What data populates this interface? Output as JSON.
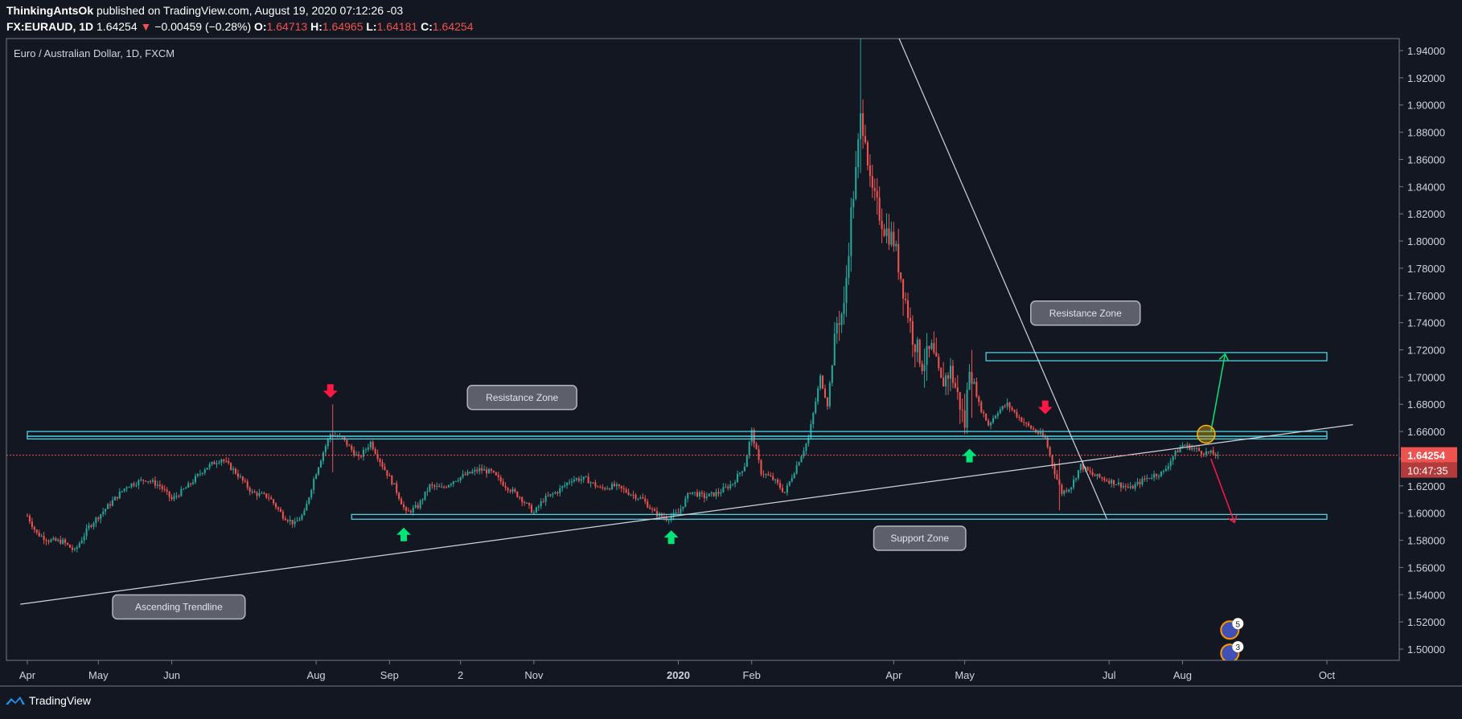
{
  "header": {
    "author": "ThinkingAntsOk",
    "published_text": "published on TradingView.com, August 19, 2020 07:12:26 -03",
    "symbol": "FX:EURAUD, 1D",
    "last": "1.64254",
    "change_arrow": "▼",
    "change": "−0.00459 (−0.28%)",
    "open_label": "O:",
    "open": "1.64713",
    "high_label": "H:",
    "high": "1.64965",
    "low_label": "L:",
    "low": "1.64181",
    "close_label": "C:",
    "close": "1.64254"
  },
  "footer": {
    "brand": "TradingView",
    "logo_icon": "tradingview-logo-icon"
  },
  "colors": {
    "background": "#131722",
    "up": "#26a69a",
    "down": "#ef5350",
    "zone": "#4dd0e1",
    "trendline": "#d1d4dc",
    "grid_text": "#d1d4dc",
    "arrow_up": "#00e676",
    "arrow_down": "#ff1744",
    "callout_bg": "#5d606b"
  },
  "chart_data": {
    "type": "candlestick",
    "title": "Euro / Australian Dollar, 1D, FXCM",
    "ylim": [
      1.49,
      1.95
    ],
    "y_ticks": [
      "1.94000",
      "1.92000",
      "1.90000",
      "1.88000",
      "1.86000",
      "1.84000",
      "1.82000",
      "1.80000",
      "1.78000",
      "1.76000",
      "1.74000",
      "1.72000",
      "1.70000",
      "1.68000",
      "1.66000",
      "1.64000",
      "1.62000",
      "1.60000",
      "1.58000",
      "1.56000",
      "1.54000",
      "1.52000",
      "1.50000"
    ],
    "x_ticks": [
      {
        "t": 0,
        "label": "Apr"
      },
      {
        "t": 30,
        "label": "May"
      },
      {
        "t": 61,
        "label": "Jun"
      },
      {
        "t": 122,
        "label": "Aug"
      },
      {
        "t": 153,
        "label": "Sep"
      },
      {
        "t": 183,
        "label": "2"
      },
      {
        "t": 214,
        "label": "Nov"
      },
      {
        "t": 275,
        "label": "2020",
        "bold": true
      },
      {
        "t": 306,
        "label": "Feb"
      },
      {
        "t": 366,
        "label": "Apr"
      },
      {
        "t": 396,
        "label": "May"
      },
      {
        "t": 457,
        "label": "Jul"
      },
      {
        "t": 488,
        "label": "Aug"
      },
      {
        "t": 549,
        "label": "Oct"
      }
    ],
    "price_path": [
      [
        0,
        1.598
      ],
      [
        4,
        1.585
      ],
      [
        9,
        1.58
      ],
      [
        15,
        1.579
      ],
      [
        20,
        1.572
      ],
      [
        26,
        1.59
      ],
      [
        34,
        1.605
      ],
      [
        42,
        1.62
      ],
      [
        50,
        1.625
      ],
      [
        56,
        1.62
      ],
      [
        61,
        1.61
      ],
      [
        68,
        1.62
      ],
      [
        75,
        1.633
      ],
      [
        82,
        1.64
      ],
      [
        88,
        1.63
      ],
      [
        95,
        1.615
      ],
      [
        102,
        1.612
      ],
      [
        108,
        1.598
      ],
      [
        113,
        1.592
      ],
      [
        117,
        1.6
      ],
      [
        121,
        1.625
      ],
      [
        125,
        1.645
      ],
      [
        128,
        1.658
      ],
      [
        133,
        1.655
      ],
      [
        140,
        1.64
      ],
      [
        145,
        1.652
      ],
      [
        150,
        1.635
      ],
      [
        155,
        1.62
      ],
      [
        160,
        1.6
      ],
      [
        165,
        1.605
      ],
      [
        170,
        1.62
      ],
      [
        175,
        1.618
      ],
      [
        180,
        1.624
      ],
      [
        185,
        1.628
      ],
      [
        191,
        1.632
      ],
      [
        196,
        1.63
      ],
      [
        202,
        1.62
      ],
      [
        208,
        1.612
      ],
      [
        214,
        1.6
      ],
      [
        218,
        1.61
      ],
      [
        224,
        1.616
      ],
      [
        230,
        1.625
      ],
      [
        236,
        1.625
      ],
      [
        242,
        1.618
      ],
      [
        248,
        1.62
      ],
      [
        254,
        1.615
      ],
      [
        260,
        1.61
      ],
      [
        265,
        1.6
      ],
      [
        270,
        1.596
      ],
      [
        275,
        1.6
      ],
      [
        280,
        1.616
      ],
      [
        286,
        1.612
      ],
      [
        292,
        1.615
      ],
      [
        298,
        1.622
      ],
      [
        303,
        1.635
      ],
      [
        306,
        1.66
      ],
      [
        310,
        1.63
      ],
      [
        315,
        1.625
      ],
      [
        320,
        1.615
      ],
      [
        325,
        1.635
      ],
      [
        330,
        1.655
      ],
      [
        335,
        1.7
      ],
      [
        338,
        1.68
      ],
      [
        342,
        1.74
      ],
      [
        345,
        1.75
      ],
      [
        348,
        1.82
      ],
      [
        350,
        1.85
      ],
      [
        352,
        1.89
      ],
      [
        354,
        1.88
      ],
      [
        356,
        1.84
      ],
      [
        358,
        1.83
      ],
      [
        362,
        1.81
      ],
      [
        366,
        1.8
      ],
      [
        370,
        1.765
      ],
      [
        374,
        1.73
      ],
      [
        378,
        1.71
      ],
      [
        382,
        1.72
      ],
      [
        386,
        1.695
      ],
      [
        390,
        1.705
      ],
      [
        394,
        1.68
      ],
      [
        396,
        1.665
      ],
      [
        398,
        1.71
      ],
      [
        402,
        1.68
      ],
      [
        406,
        1.665
      ],
      [
        410,
        1.675
      ],
      [
        414,
        1.68
      ],
      [
        418,
        1.672
      ],
      [
        422,
        1.665
      ],
      [
        426,
        1.66
      ],
      [
        430,
        1.655
      ],
      [
        434,
        1.63
      ],
      [
        437,
        1.615
      ],
      [
        441,
        1.62
      ],
      [
        445,
        1.635
      ],
      [
        450,
        1.628
      ],
      [
        455,
        1.625
      ],
      [
        460,
        1.622
      ],
      [
        466,
        1.618
      ],
      [
        472,
        1.625
      ],
      [
        476,
        1.628
      ],
      [
        480,
        1.63
      ],
      [
        484,
        1.642
      ],
      [
        488,
        1.65
      ],
      [
        492,
        1.648
      ],
      [
        496,
        1.645
      ],
      [
        500,
        1.644
      ],
      [
        503,
        1.6425
      ]
    ],
    "spikes": [
      {
        "t": 352,
        "high": 1.965,
        "low": 1.85
      },
      {
        "t": 129,
        "high": 1.68,
        "low": 1.63
      },
      {
        "t": 399,
        "high": 1.72,
        "low": 1.67
      },
      {
        "t": 436,
        "high": 1.64,
        "low": 1.602
      }
    ],
    "last_price": {
      "value": 1.64254,
      "label": "1.64254",
      "countdown": "10:47:35"
    },
    "zones": [
      {
        "name": "resistance-zone-1",
        "from_t": 0,
        "to_t": 549,
        "top": 1.66,
        "bottom": 1.6565
      },
      {
        "name": "resistance-zone-1b",
        "from_t": 0,
        "to_t": 549,
        "top": 1.6565,
        "bottom": 1.6545
      },
      {
        "name": "support-zone",
        "from_t": 137,
        "to_t": 549,
        "top": 1.599,
        "bottom": 1.5955
      },
      {
        "name": "resistance-zone-2",
        "from_t": 405,
        "to_t": 549,
        "top": 1.718,
        "bottom": 1.712
      }
    ],
    "trendlines": [
      {
        "name": "ascending-trendline",
        "t1": -3,
        "p1": 1.533,
        "t2": 560,
        "p2": 1.665
      },
      {
        "name": "descending-trendline",
        "t1": 368,
        "p1": 1.95,
        "t2": 456,
        "p2": 1.596
      }
    ],
    "annotations": [
      {
        "name": "resistance-zone-callout",
        "text": "Resistance Zone",
        "t": 209,
        "p": 1.685
      },
      {
        "name": "resistance-zone-callout-2",
        "text": "Resistance Zone",
        "t": 447,
        "p": 1.747
      },
      {
        "name": "support-zone-callout",
        "text": "Support Zone",
        "t": 377,
        "p": 1.5815
      },
      {
        "name": "ascending-trendline-callout",
        "text": "Ascending Trendline",
        "t": 64,
        "p": 1.531
      }
    ],
    "signal_arrows": [
      {
        "name": "arrow-down-1",
        "dir": "down",
        "t": 128,
        "p": 1.69
      },
      {
        "name": "arrow-up-1",
        "dir": "up",
        "t": 159,
        "p": 1.584
      },
      {
        "name": "arrow-up-2",
        "dir": "up",
        "t": 272,
        "p": 1.582
      },
      {
        "name": "arrow-up-3",
        "dir": "up",
        "t": 398,
        "p": 1.642
      },
      {
        "name": "arrow-down-2",
        "dir": "down",
        "t": 430,
        "p": 1.678
      }
    ],
    "projections": [
      {
        "name": "bullish-projection",
        "t1": 500,
        "p1": 1.66,
        "t2": 506,
        "p2": 1.717,
        "color": "#00e676"
      },
      {
        "name": "bearish-projection",
        "t1": 500,
        "p1": 1.64,
        "t2": 510,
        "p2": 1.593,
        "color": "#ff1744"
      }
    ],
    "highlight_circle": {
      "t": 498,
      "p": 1.658
    },
    "event_badges": [
      {
        "name": "event-badge-1",
        "t": 508,
        "p": 1.514,
        "count": "5"
      },
      {
        "name": "event-badge-2",
        "t": 508,
        "p": 1.497,
        "count": "3"
      }
    ]
  }
}
